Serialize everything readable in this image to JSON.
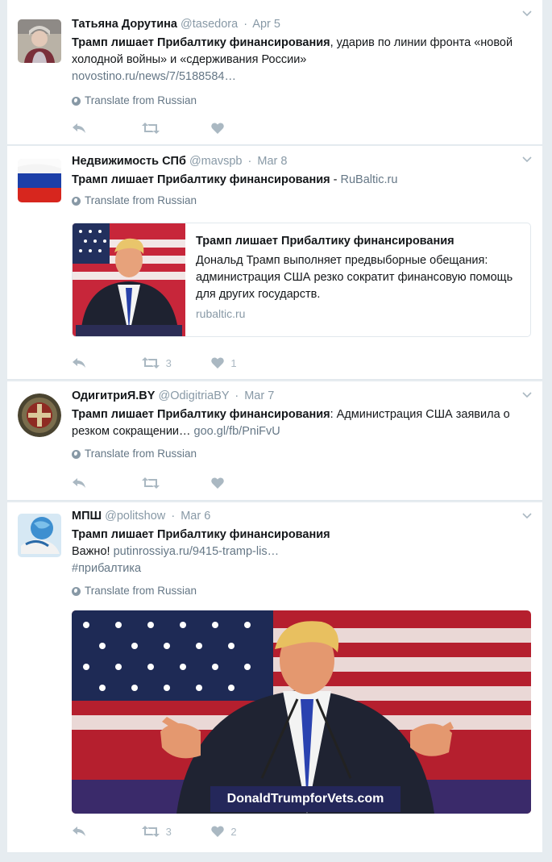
{
  "tweets": [
    {
      "name": "Татьяна Дорутина",
      "handle": "@tasedora",
      "date": "Apr 5",
      "headline": "Трамп лишает Прибалтику финансирования",
      "text_rest": ", ударив по линии фронта «новой холодной войны» и «сдерживания России»",
      "link": "novostino.ru/news/7/5188584…",
      "translate": "Translate from Russian"
    },
    {
      "name": "Недвижимость СПб",
      "handle": "@mavspb",
      "date": "Mar 8",
      "headline": "Трамп лишает Прибалтику финансирования",
      "text_rest": " - ",
      "link": "RuBaltic.ru",
      "translate": "Translate from Russian",
      "card": {
        "title": "Трамп лишает Прибалтику финансирования",
        "description": "Дональд Трамп выполняет предвыборные обещания: администрация США резко сократит финансовую помощь для других государств.",
        "domain": "rubaltic.ru"
      },
      "retweets": "3",
      "likes": "1"
    },
    {
      "name": "ОдигитриЯ.BY",
      "handle": "@OdigitriaBY",
      "date": "Mar 7",
      "headline": "Трамп лишает Прибалтику финансирования",
      "text_rest": ": Администрация США заявила о резком сокращении…",
      "link": "goo.gl/fb/PniFvU",
      "translate": "Translate from Russian"
    },
    {
      "name": "МПШ",
      "handle": "@politshow",
      "date": "Mar 6",
      "headline": "Трамп лишает Прибалтику финансирования",
      "line2_prefix": "Важно!",
      "link": "putinrossiya.ru/9415-tramp-lis…",
      "hashtag": "#прибалтика",
      "translate": "Translate from Russian",
      "image_caption": "DonaldTrumpforVets.com",
      "retweets": "3",
      "likes": "2"
    }
  ],
  "icons": {
    "reply": "reply-icon",
    "retweet": "retweet-icon",
    "like": "heart-icon",
    "caret": "chevron-down-icon",
    "globe": "globe-icon"
  },
  "colors": {
    "background": "#e6ecf0",
    "muted": "#8899a6",
    "icon": "#aab8c2",
    "text": "#14171a"
  }
}
